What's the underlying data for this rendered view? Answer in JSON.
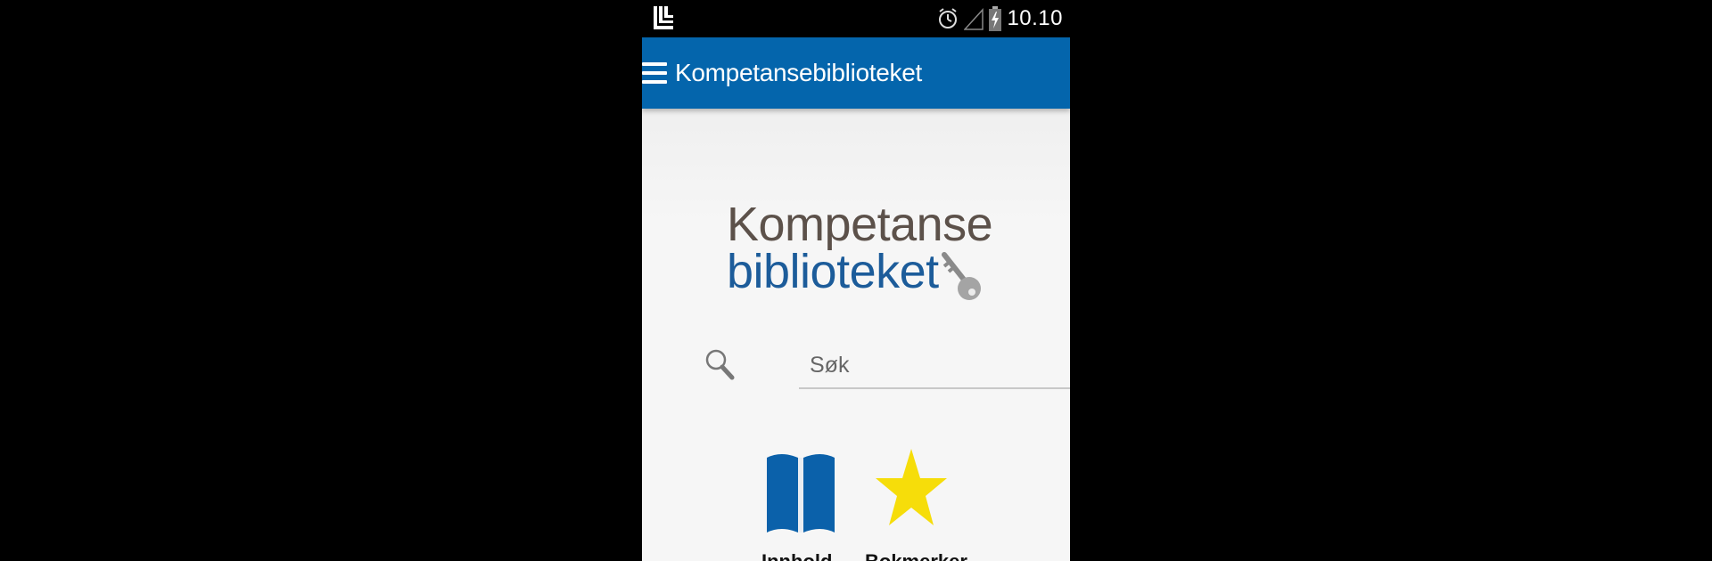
{
  "status_bar": {
    "time": "10.10",
    "icons": [
      "app-notification-icon",
      "alarm-icon",
      "signal-icon",
      "battery-charging-icon"
    ]
  },
  "app_bar": {
    "menu_icon": "hamburger-menu-icon",
    "title": "Kompetansebiblioteket"
  },
  "logo": {
    "line1": "Kompetanse",
    "line2": "biblioteket",
    "icon": "key-icon"
  },
  "search": {
    "placeholder": "Søk",
    "value": "",
    "icon": "search-icon"
  },
  "tiles": [
    {
      "label": "Innhold",
      "icon": "book-icon",
      "color": "#0b61aa"
    },
    {
      "label": "Bokmerker",
      "icon": "star-icon",
      "color": "#f6dd0a"
    }
  ],
  "colors": {
    "app_bar": "#0465ac",
    "logo_dark": "#5c514a",
    "logo_blue": "#1c5c9a"
  }
}
